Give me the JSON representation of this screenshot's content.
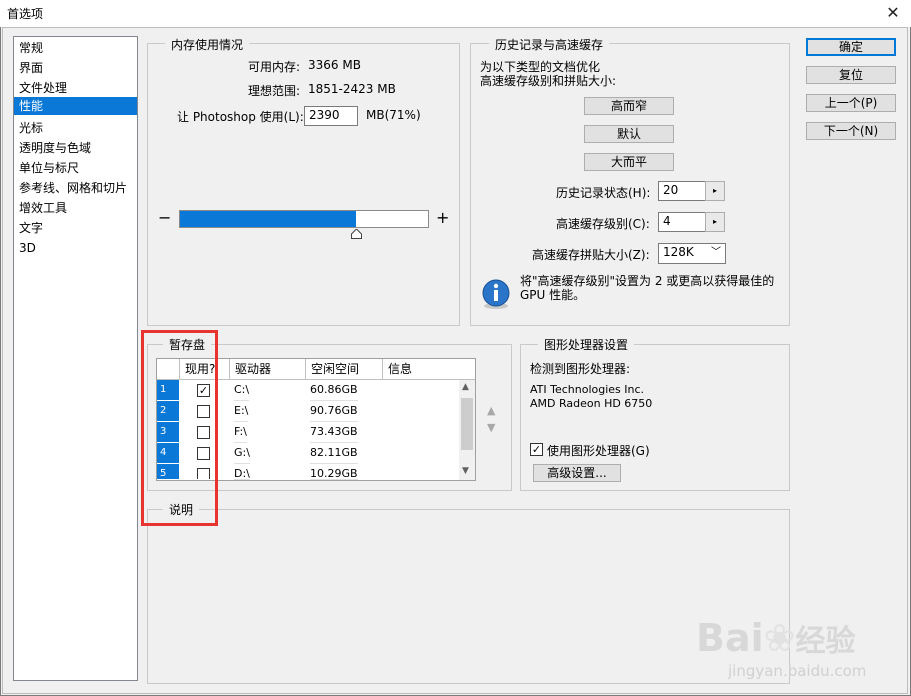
{
  "window": {
    "title": "首选项",
    "close_glyph": "✕"
  },
  "sidebar": {
    "items": [
      {
        "label": "常规"
      },
      {
        "label": "界面"
      },
      {
        "label": "文件处理"
      },
      {
        "label": "性能",
        "selected": true
      },
      {
        "label": "光标"
      },
      {
        "label": "透明度与色域"
      },
      {
        "label": "单位与标尺"
      },
      {
        "label": "参考线、网格和切片"
      },
      {
        "label": "增效工具"
      },
      {
        "label": "文字"
      },
      {
        "label": "3D"
      }
    ]
  },
  "memory": {
    "title": "内存使用情况",
    "available_label": "可用内存:",
    "available_value": "3366 MB",
    "ideal_label": "理想范围:",
    "ideal_value": "1851-2423 MB",
    "let_label": "让 Photoshop 使用(L):",
    "use_value": "2390",
    "use_unit": "MB(71%)",
    "minus": "−",
    "plus": "+",
    "slider_fraction": 0.71
  },
  "history": {
    "title": "历史记录与高速缓存",
    "desc_line1": "为以下类型的文档优化",
    "desc_line2": "高速缓存级别和拼贴大小:",
    "btn_tall_thin": "高而窄",
    "btn_default": "默认",
    "btn_big_flat": "大而平",
    "states_label": "历史记录状态(H):",
    "states_value": "20",
    "cache_levels_label": "高速缓存级别(C):",
    "cache_levels_value": "4",
    "tile_size_label": "高速缓存拼贴大小(Z):",
    "tile_size_value": "128K",
    "info_line1": "将\"高速缓存级别\"设置为 2 或更高以获得最佳的",
    "info_line2": "GPU 性能。"
  },
  "scratch": {
    "title": "暂存盘",
    "headers": {
      "active": "现用?",
      "drive": "驱动器",
      "free": "空闲空间",
      "info": "信息"
    },
    "rows": [
      {
        "num": "1",
        "checked": true,
        "drive": "C:\\",
        "free": "60.86GB"
      },
      {
        "num": "2",
        "checked": false,
        "drive": "E:\\",
        "free": "90.76GB"
      },
      {
        "num": "3",
        "checked": false,
        "drive": "F:\\",
        "free": "73.43GB"
      },
      {
        "num": "4",
        "checked": false,
        "drive": "G:\\",
        "free": "82.11GB"
      },
      {
        "num": "5",
        "checked": false,
        "drive": "D:\\",
        "free": "10.29GB"
      }
    ]
  },
  "gpu": {
    "title": "图形处理器设置",
    "detected_label": "检测到图形处理器:",
    "vendor": "ATI Technologies Inc.",
    "model": "AMD Radeon HD 6750",
    "use_gpu_label": "使用图形处理器(G)",
    "use_gpu_checked": true,
    "advanced_btn": "高级设置..."
  },
  "description": {
    "title": "说明"
  },
  "buttons": {
    "ok": "确定",
    "reset": "复位",
    "prev": "上一个(P)",
    "next": "下一个(N)"
  },
  "watermark": {
    "brand": "Bai",
    "brand_cn": "经验",
    "url": "jingyan.baidu.com"
  },
  "colors": {
    "accent": "#0a78d7",
    "highlight": "#e8342e"
  }
}
